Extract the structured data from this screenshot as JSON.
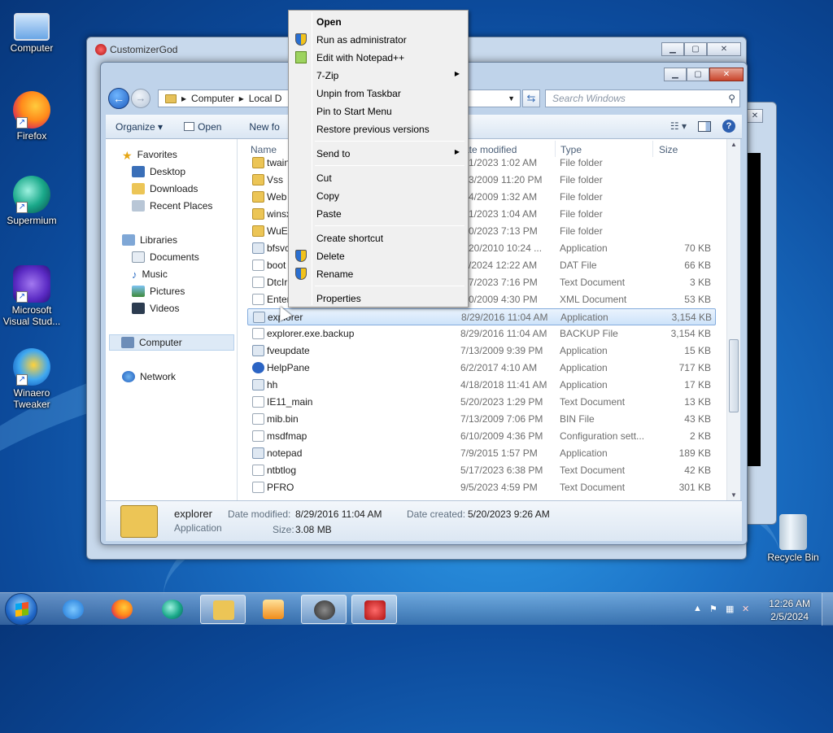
{
  "desktop": {
    "icons": [
      {
        "label": "Computer"
      },
      {
        "label": "Firefox"
      },
      {
        "label": "Supermium"
      },
      {
        "label": "Microsoft Visual Stud..."
      },
      {
        "label": "Winaero Tweaker"
      },
      {
        "label": "Recycle Bin"
      }
    ]
  },
  "back_window": {
    "title": "CustomizerGod"
  },
  "explorer": {
    "address": {
      "segments": [
        "Computer",
        "Local D"
      ],
      "search_placeholder": "Search Windows"
    },
    "toolbar": {
      "organize": "Organize ▾",
      "open": "Open",
      "new_folder": "New fo"
    },
    "nav": {
      "favorites": "Favorites",
      "desktop": "Desktop",
      "downloads": "Downloads",
      "recent": "Recent Places",
      "libraries": "Libraries",
      "documents": "Documents",
      "music": "Music",
      "pictures": "Pictures",
      "videos": "Videos",
      "computer": "Computer",
      "network": "Network"
    },
    "columns": {
      "name": "Name",
      "date": "ate modified",
      "type": "Type",
      "size": "Size"
    },
    "rows": [
      {
        "name": "twain",
        "date": "/21/2023 1:02 AM",
        "type": "File folder",
        "size": ""
      },
      {
        "name": "Vss",
        "date": "/13/2009 11:20 PM",
        "type": "File folder",
        "size": ""
      },
      {
        "name": "Web",
        "date": "/14/2009 1:32 AM",
        "type": "File folder",
        "size": ""
      },
      {
        "name": "winsx",
        "date": "/21/2023 1:04 AM",
        "type": "File folder",
        "size": ""
      },
      {
        "name": "WuE",
        "date": "/20/2023 7:13 PM",
        "type": "File folder",
        "size": ""
      },
      {
        "name": "bfsvc",
        "date": "1/20/2010 10:24 ...",
        "type": "Application",
        "size": "70 KB"
      },
      {
        "name": "boot",
        "date": "/5/2024 12:22 AM",
        "type": "DAT File",
        "size": "66 KB"
      },
      {
        "name": "DtcIr",
        "date": "/17/2023 7:16 PM",
        "type": "Text Document",
        "size": "3 KB"
      },
      {
        "name": "Enter",
        "date": "/10/2009 4:30 PM",
        "type": "XML Document",
        "size": "53 KB"
      },
      {
        "name": "explorer",
        "date": "8/29/2016 11:04 AM",
        "type": "Application",
        "size": "3,154 KB"
      },
      {
        "name": "explorer.exe.backup",
        "date": "8/29/2016 11:04 AM",
        "type": "BACKUP File",
        "size": "3,154 KB"
      },
      {
        "name": "fveupdate",
        "date": "7/13/2009 9:39 PM",
        "type": "Application",
        "size": "15 KB"
      },
      {
        "name": "HelpPane",
        "date": "6/2/2017 4:10 AM",
        "type": "Application",
        "size": "717 KB"
      },
      {
        "name": "hh",
        "date": "4/18/2018 11:41 AM",
        "type": "Application",
        "size": "17 KB"
      },
      {
        "name": "IE11_main",
        "date": "5/20/2023 1:29 PM",
        "type": "Text Document",
        "size": "13 KB"
      },
      {
        "name": "mib.bin",
        "date": "7/13/2009 7:06 PM",
        "type": "BIN File",
        "size": "43 KB"
      },
      {
        "name": "msdfmap",
        "date": "6/10/2009 4:36 PM",
        "type": "Configuration sett...",
        "size": "2 KB"
      },
      {
        "name": "notepad",
        "date": "7/9/2015 1:57 PM",
        "type": "Application",
        "size": "189 KB"
      },
      {
        "name": "ntbtlog",
        "date": "5/17/2023 6:38 PM",
        "type": "Text Document",
        "size": "42 KB"
      },
      {
        "name": "PFRO",
        "date": "9/5/2023 4:59 PM",
        "type": "Text Document",
        "size": "301 KB"
      }
    ],
    "details": {
      "name": "explorer",
      "kind": "Application",
      "modified_label": "Date modified:",
      "modified": "8/29/2016 11:04 AM",
      "created_label": "Date created:",
      "created": "5/20/2023 9:26 AM",
      "size_label": "Size:",
      "size": "3.08 MB"
    }
  },
  "context_menu": {
    "items": [
      {
        "label": "Open"
      },
      {
        "label": "Run as administrator"
      },
      {
        "label": "Edit with Notepad++"
      },
      {
        "label": "7-Zip"
      },
      {
        "label": "Unpin from Taskbar"
      },
      {
        "label": "Pin to Start Menu"
      },
      {
        "label": "Restore previous versions"
      },
      {
        "label": "Send to"
      },
      {
        "label": "Cut"
      },
      {
        "label": "Copy"
      },
      {
        "label": "Paste"
      },
      {
        "label": "Create shortcut"
      },
      {
        "label": "Delete"
      },
      {
        "label": "Rename"
      },
      {
        "label": "Properties"
      }
    ]
  },
  "taskbar": {
    "time": "12:26 AM",
    "date": "2/5/2024"
  }
}
